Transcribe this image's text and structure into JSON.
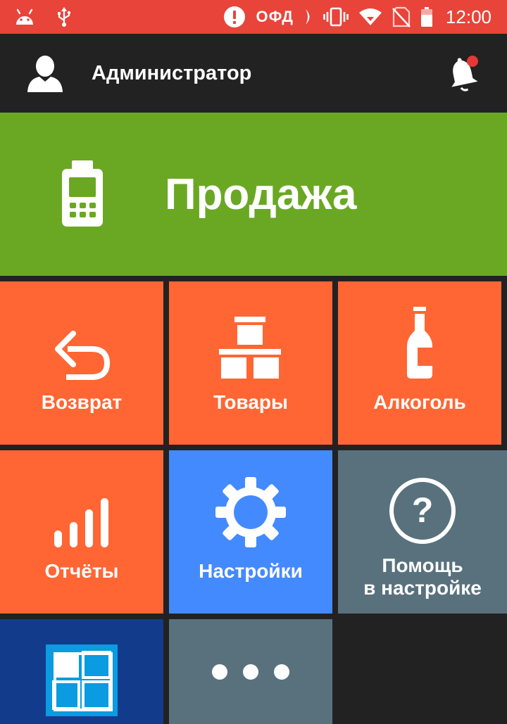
{
  "colors": {
    "status_bar": "#E8443A",
    "app_bar": "#222222",
    "sale": "#6AA823",
    "orange": "#FF6633",
    "blue": "#448AFF",
    "slate": "#58717D",
    "navy": "#123B8C",
    "notification_dot": "#E53935"
  },
  "status_bar": {
    "ofd_label": "ОФД",
    "time": "12:00"
  },
  "app_bar": {
    "user_name": "Администратор"
  },
  "tiles": {
    "sale": {
      "label": "Продажа",
      "icon": "payment-terminal-icon"
    },
    "return": {
      "label": "Возврат",
      "icon": "undo-arrow-icon"
    },
    "goods": {
      "label": "Товары",
      "icon": "boxes-icon"
    },
    "alcohol": {
      "label": "Алкоголь",
      "icon": "bottle-icon"
    },
    "reports": {
      "label": "Отчёты",
      "icon": "signal-bars-icon"
    },
    "settings": {
      "label": "Настройки",
      "icon": "gear-icon"
    },
    "help": {
      "label_line1": "Помощь",
      "label_line2": "в настройке",
      "icon": "question-circle-icon"
    },
    "app_store": {
      "icon": "app-grid-icon"
    },
    "more": {
      "icon": "more-dots-icon"
    }
  }
}
